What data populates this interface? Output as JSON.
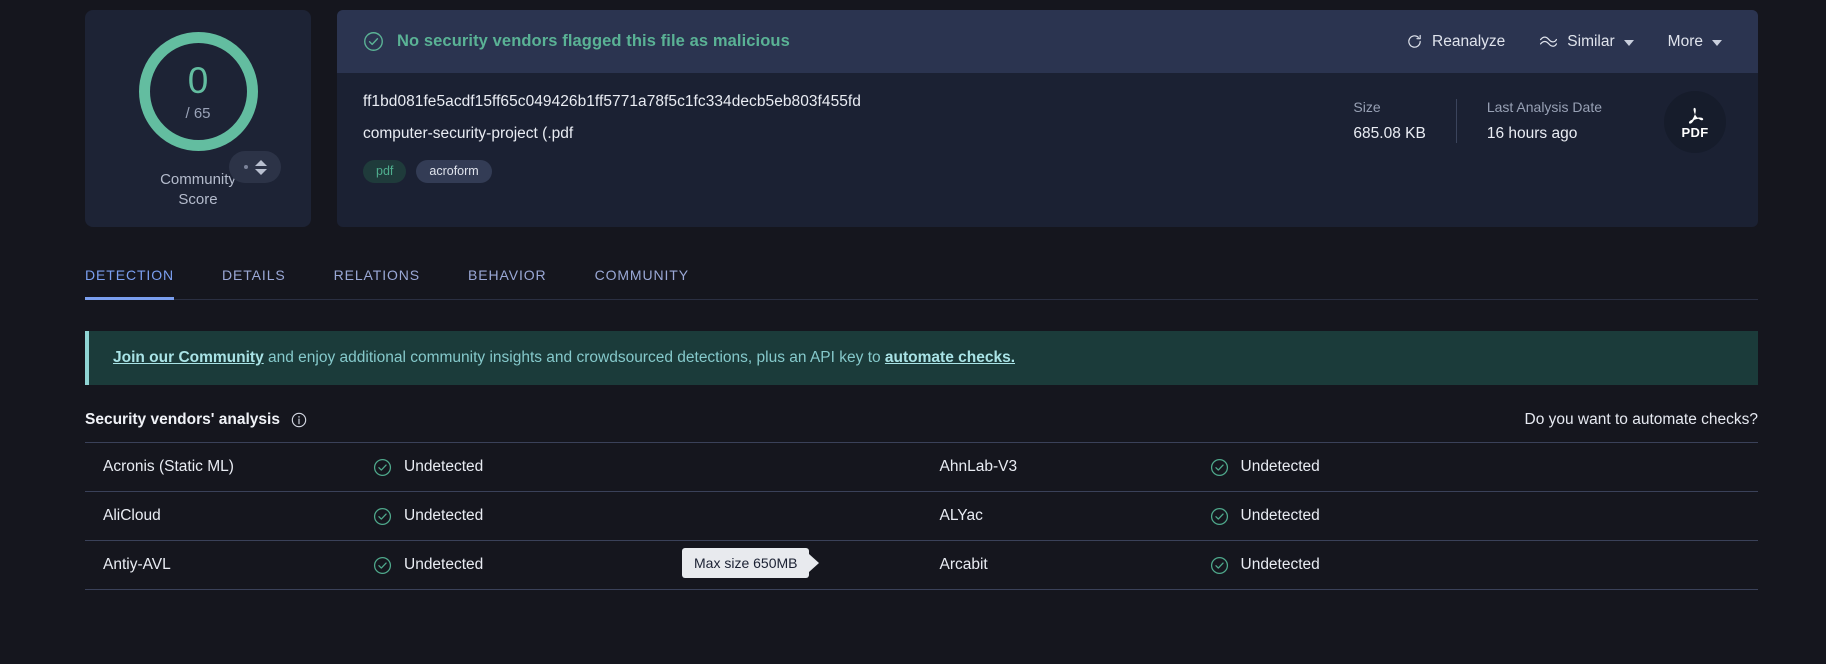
{
  "score_card": {
    "score": "0",
    "total": "/ 65",
    "label": "Community\nScore",
    "label_line1": "Community",
    "label_line2": "Score",
    "vote_icon": "vote-arrows-icon"
  },
  "file_header": {
    "verdict_icon": "check-circle-icon",
    "verdict": "No security vendors flagged this file as malicious",
    "actions": [
      {
        "label": "Reanalyze",
        "icon": "refresh-icon",
        "has_chevron": false
      },
      {
        "label": "Similar",
        "icon": "similar-waves-icon",
        "has_chevron": true
      },
      {
        "label": "More",
        "icon": "",
        "has_chevron": true
      }
    ]
  },
  "file_info": {
    "hash": "ff1bd081fe5acdf15ff65c049426b1ff5771a78f5c1fc334decb5eb803f455fd",
    "name": "computer-security-project (.pdf",
    "tags": [
      {
        "text": "pdf",
        "style": "green"
      },
      {
        "text": "acroform",
        "style": "grey"
      }
    ],
    "meta": [
      {
        "label": "Size",
        "value": "685.08 KB"
      },
      {
        "label": "Last Analysis Date",
        "value": "16 hours ago"
      }
    ],
    "file_type_badge": {
      "text": "PDF",
      "icon": "pdf-acrobat-icon"
    }
  },
  "tabs": [
    {
      "label": "DETECTION",
      "active": true
    },
    {
      "label": "DETAILS",
      "active": false
    },
    {
      "label": "RELATIONS",
      "active": false
    },
    {
      "label": "BEHAVIOR",
      "active": false
    },
    {
      "label": "COMMUNITY",
      "active": false
    }
  ],
  "banner": {
    "link1": "Join our Community",
    "mid": " and enjoy additional community insights and crowdsourced detections, plus an API key to ",
    "link2": "automate checks."
  },
  "vendors_section": {
    "title": "Security vendors' analysis",
    "info_icon": "info-circle-icon",
    "automate_link": "Do you want to automate checks?"
  },
  "vendor_rows": [
    {
      "left": {
        "name": "Acronis (Static ML)",
        "result": "Undetected",
        "icon": "check-circle-icon"
      },
      "right": {
        "name": "AhnLab-V3",
        "result": "Undetected",
        "icon": "check-circle-icon"
      }
    },
    {
      "left": {
        "name": "AliCloud",
        "result": "Undetected",
        "icon": "check-circle-icon"
      },
      "right": {
        "name": "ALYac",
        "result": "Undetected",
        "icon": "check-circle-icon"
      }
    },
    {
      "left": {
        "name": "Antiy-AVL",
        "result": "Undetected",
        "icon": "check-circle-icon"
      },
      "right": {
        "name": "Arcabit",
        "result": "Undetected",
        "icon": "check-circle-icon"
      }
    }
  ],
  "tooltip": {
    "text": "Max size 650MB"
  },
  "colors": {
    "page_bg": "#15161e",
    "card_bg": "#1d2335",
    "header_bg": "#2b3450",
    "accent_green": "#5ab295",
    "donut_green": "#63bda0",
    "tab_active": "#7b9ff0",
    "banner_bg": "#1b3b3a",
    "banner_text": "#85c9cb"
  }
}
